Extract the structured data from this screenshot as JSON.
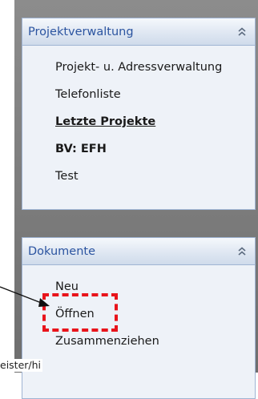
{
  "panels": [
    {
      "title": "Projektverwaltung",
      "items": [
        {
          "label": "Projekt- u. Adressverwaltung",
          "bold": false,
          "underline": false
        },
        {
          "label": "Telefonliste",
          "bold": false,
          "underline": false
        },
        {
          "label": "Letzte Projekte",
          "bold": true,
          "underline": true
        },
        {
          "label": "BV: EFH",
          "bold": true,
          "underline": false
        },
        {
          "label": "Test",
          "bold": false,
          "underline": false
        }
      ]
    },
    {
      "title": "Dokumente",
      "items": [
        {
          "label": "Neu",
          "bold": false,
          "underline": false
        },
        {
          "label": "Öffnen",
          "bold": false,
          "underline": false
        },
        {
          "label": "Zusammenziehen",
          "bold": false,
          "underline": false
        }
      ]
    }
  ],
  "cut_label": "eister/hi",
  "icons": {
    "collapse": "double-chevron-up-icon"
  },
  "colors": {
    "highlight": "#e8141b",
    "panel_title": "#2b54a0"
  }
}
